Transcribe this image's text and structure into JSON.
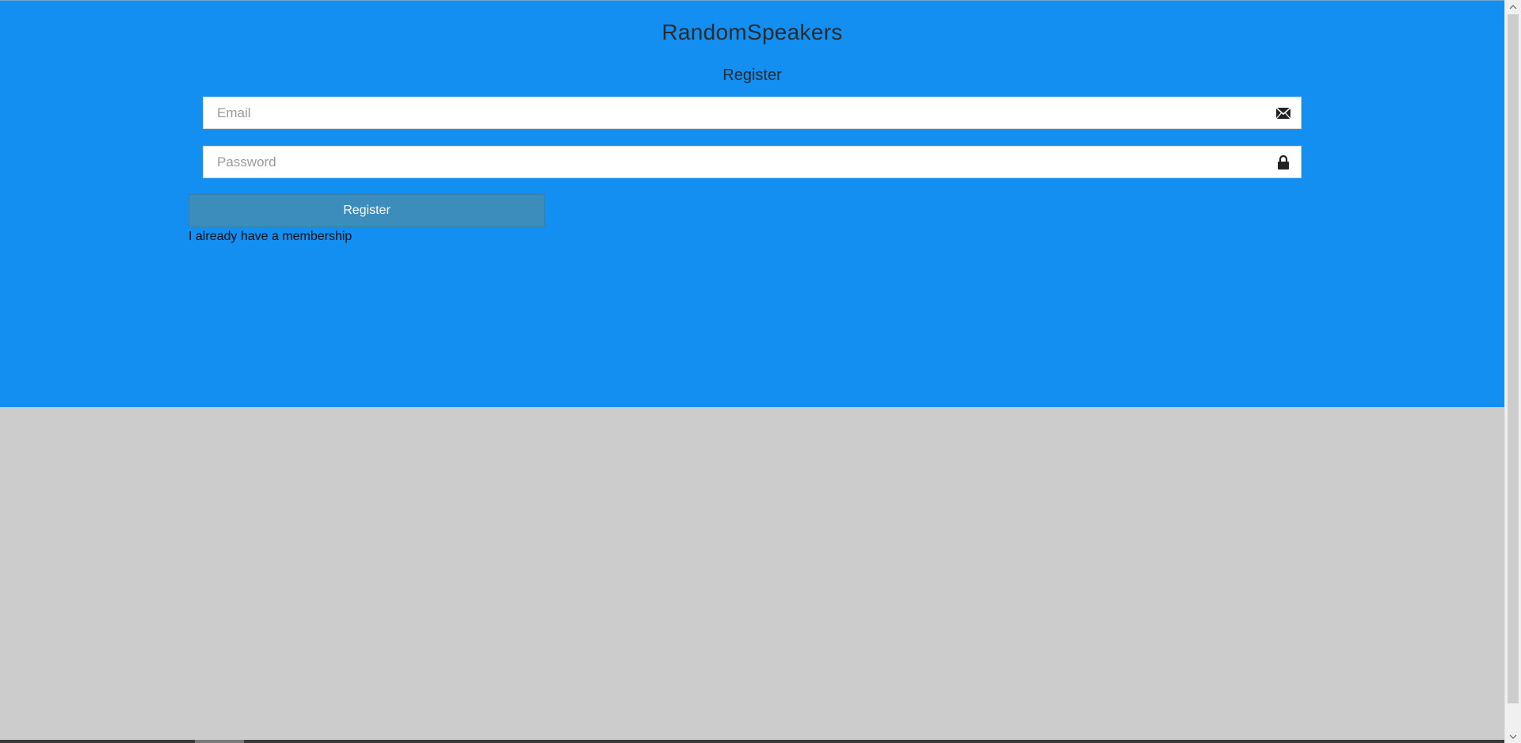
{
  "app": {
    "title": "RandomSpeakers"
  },
  "form": {
    "heading": "Register",
    "email": {
      "placeholder": "Email",
      "value": "",
      "icon": "envelope-icon"
    },
    "password": {
      "placeholder": "Password",
      "value": "",
      "icon": "lock-icon"
    },
    "submit_label": "Register",
    "membership_link": "I already have a membership"
  },
  "colors": {
    "panel": "#138ef1",
    "page_background": "#cccccc",
    "button": "#3c8dbc",
    "text_dark": "#2b2b2b"
  }
}
